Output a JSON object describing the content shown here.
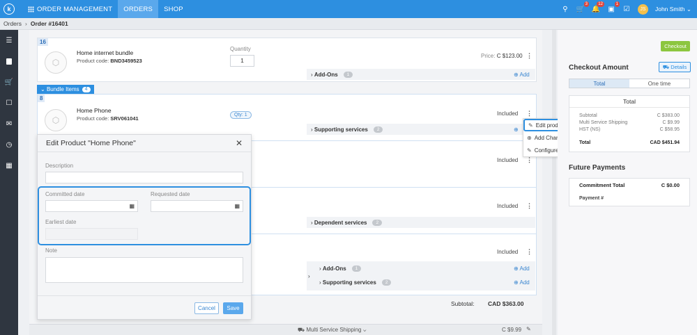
{
  "topbar": {
    "logo": "k",
    "nav": [
      {
        "label": "ORDER MANAGEMENT",
        "active": false
      },
      {
        "label": "ORDERS",
        "active": true
      },
      {
        "label": "SHOP",
        "active": false
      }
    ],
    "cart_badge": "3",
    "bell_badge": "12",
    "notif_badge": "1",
    "avatar_initials": "JS",
    "user_name": "John Smith"
  },
  "breadcrumb": {
    "root": "Orders",
    "current": "Order #16401"
  },
  "main": {
    "product1": {
      "index": "16",
      "name": "Home internet bundle",
      "code_label": "Product code:",
      "code": "BND3459523",
      "quantity_label": "Quantity",
      "quantity": "1",
      "price_label": "Price:",
      "price": "C $123.00",
      "addons_label": "Add-Ons",
      "addons_count": "1",
      "add_label": "Add"
    },
    "bundle": {
      "label": "Bundle Items",
      "count": "4"
    },
    "product2": {
      "index": "8",
      "name": "Home Phone",
      "code_label": "Product code:",
      "code": "SRV061041",
      "qty_pill": "Qty: 1",
      "included": "Included",
      "supporting_label": "Supporting services",
      "supporting_count": "2"
    },
    "product3": {
      "included": "Included"
    },
    "product4": {
      "included": "Included",
      "dependent_label": "Dependent services",
      "dependent_count": "2"
    },
    "product5": {
      "included": "Included",
      "addons_label": "Add-Ons",
      "addons_count": "1",
      "supporting_label": "Supporting services",
      "supporting_count": "2",
      "add_label": "Add"
    },
    "subtotal_label": "Subtotal:",
    "subtotal_value": "CAD $363.00",
    "footer": {
      "shipping_label": "Multi Service Shipping",
      "shipping_value": "C $9.99"
    }
  },
  "context_menu": {
    "items": [
      "Edit product",
      "Add Charges",
      "Configure"
    ]
  },
  "modal": {
    "title": "Edit Product \"Home Phone\"",
    "description_label": "Description",
    "committed_label": "Committed date",
    "requested_label": "Requested date",
    "earliest_label": "Earliest date",
    "note_label": "Note",
    "cancel": "Cancel",
    "save": "Save"
  },
  "right": {
    "checkout": "Checkout",
    "checkout_amount": "Checkout Amount",
    "details": "Details",
    "tabs": [
      "Total",
      "One time"
    ],
    "total_header": "Total",
    "rows": [
      {
        "label": "Subtotal",
        "value": "C $383.00"
      },
      {
        "label": "Multi Service Shipping",
        "value": "C $9.99"
      },
      {
        "label": "HST (NS)",
        "value": "C $58.95"
      }
    ],
    "total_label": "Total",
    "total_value": "CAD $451.94",
    "future_payments": "Future Payments",
    "commitment_label": "Commitment Total",
    "commitment_value": "C $0.00",
    "payment_label": "Payment #"
  },
  "colors": {
    "primary": "#2d8fe0",
    "checkout": "#8cc63f",
    "sidebar": "#2f3640"
  }
}
